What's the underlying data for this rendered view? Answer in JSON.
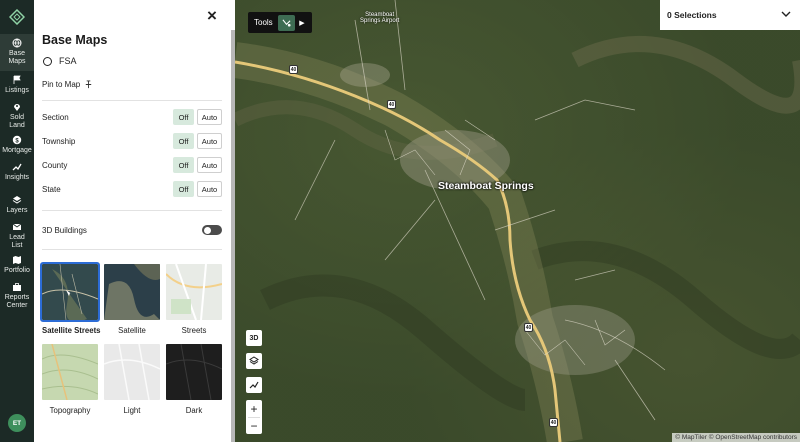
{
  "rail": {
    "items": [
      {
        "label": "Base\nMaps",
        "icon": "globe-icon"
      },
      {
        "label": "Listings",
        "icon": "flag-icon"
      },
      {
        "label": "Sold\nLand",
        "icon": "pin-icon"
      },
      {
        "label": "Mortgage",
        "icon": "dollar-icon"
      },
      {
        "label": "Insights",
        "icon": "trend-icon"
      },
      {
        "label": "Layers",
        "icon": "layers-icon"
      },
      {
        "label": "Lead\nList",
        "icon": "mail-icon"
      },
      {
        "label": "Portfolio",
        "icon": "map-icon"
      },
      {
        "label": "Reports\nCenter",
        "icon": "briefcase-icon"
      }
    ],
    "avatar": "ET"
  },
  "panel": {
    "title": "Base Maps",
    "fsa_label": "FSA",
    "pin_label": "Pin to Map",
    "rows": [
      {
        "label": "Section",
        "off": "Off",
        "auto": "Auto"
      },
      {
        "label": "Township",
        "off": "Off",
        "auto": "Auto"
      },
      {
        "label": "County",
        "off": "Off",
        "auto": "Auto"
      },
      {
        "label": "State",
        "off": "Off",
        "auto": "Auto"
      }
    ],
    "buildings_label": "3D Buildings",
    "basemaps": [
      {
        "label": "Satellite Streets",
        "selected": true
      },
      {
        "label": "Satellite",
        "selected": false
      },
      {
        "label": "Streets",
        "selected": false
      },
      {
        "label": "Topography",
        "selected": false
      },
      {
        "label": "Light",
        "selected": false
      },
      {
        "label": "Dark",
        "selected": false
      }
    ]
  },
  "map": {
    "tools_label": "Tools",
    "selections_label": "0 Selections",
    "city_label": "Steamboat Springs",
    "airport_label": "Steamboat\nSprings Airport",
    "ctl_3d": "3D",
    "zoom_in": "+",
    "zoom_out": "−",
    "attribution": "© MapTiler © OpenStreetMap contributors",
    "shields": [
      "40",
      "40",
      "40",
      "40"
    ]
  },
  "colors": {
    "rail_bg": "#1c2a26",
    "accent_green": "#3e8f5c",
    "selected_blue": "#2c6cd6",
    "off_bg": "#d7e9dd"
  }
}
